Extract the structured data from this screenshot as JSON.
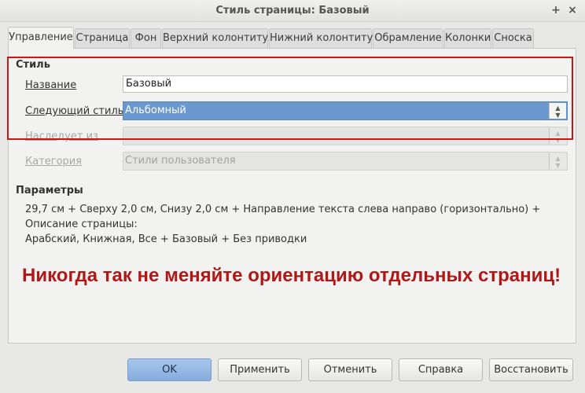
{
  "window": {
    "title": "Стиль страницы: Базовый",
    "plus_glyph": "+",
    "close_glyph": "×"
  },
  "tabs": [
    {
      "label": "Управление"
    },
    {
      "label": "Страница"
    },
    {
      "label": "Фон"
    },
    {
      "label": "Верхний колонтитул"
    },
    {
      "label": "Нижний колонтитул"
    },
    {
      "label": "Обрамление"
    },
    {
      "label": "Колонки"
    },
    {
      "label": "Сноска"
    }
  ],
  "style_section": {
    "heading": "Стиль",
    "name_label": "Название",
    "name_value": "Базовый",
    "next_label": "Следующий стиль",
    "next_value": "Альбомный",
    "inherits_label": "Наследует из",
    "inherits_value": "",
    "category_label": "Категория",
    "category_value": "Стили пользователя"
  },
  "parameters": {
    "heading": "Параметры",
    "text_line1": "29,7 см + Сверху 2,0 см, Снизу 2,0 см + Направление текста слева направо (горизонтально) + Описание страницы:",
    "text_line2": "Арабский, Книжная, Все + Базовый + Без приводки"
  },
  "annotation": {
    "warning": "Никогда так не меняйте ориентацию отдельных страниц!",
    "color": "#b01818"
  },
  "buttons": {
    "ok": "OK",
    "apply": "Применить",
    "cancel": "Отменить",
    "help": "Справка",
    "reset": "Восстановить"
  },
  "colors": {
    "highlight_border": "#c11a1a",
    "selection": "#6b98cf"
  }
}
